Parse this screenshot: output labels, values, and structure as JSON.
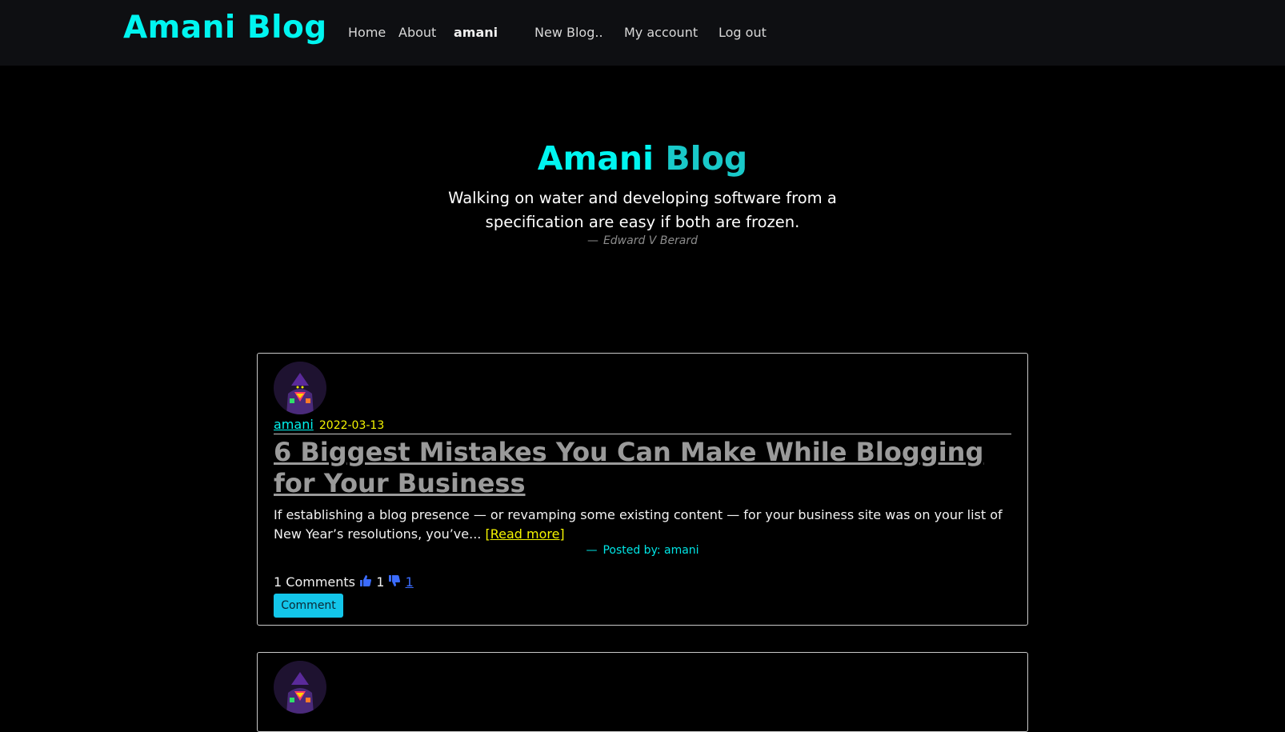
{
  "nav": {
    "brand": "Amani Blog",
    "links": [
      "Home",
      "About",
      "amani",
      "New Blog..",
      "My account",
      "Log out"
    ]
  },
  "hero": {
    "title_part1": "Amani",
    "title_part2": "Blog",
    "quote": "Walking on water and developing software from a specification are easy if both are frozen.",
    "dash": "—",
    "author": "Edward V Berard"
  },
  "posts": [
    {
      "author": "amani",
      "date": "2022-03-13",
      "title": "6 Biggest Mistakes You Can Make While Blogging for Your Business",
      "excerpt": "If establishing a blog presence — or revamping some existing content — for your business site was on your list of New Year’s resolutions, you’ve...",
      "read_more": "[Read more]",
      "dash": "—",
      "posted_by": "Posted by: amani",
      "comments": "1 Comments",
      "likes": "1",
      "dislikes": "1",
      "comment_button": "Comment"
    }
  ],
  "icons": {
    "like": "thumbs-up-icon",
    "dislike": "thumbs-down-icon",
    "avatar": "avatar-image"
  },
  "colors": {
    "accent": "#00f5f0",
    "date": "#f4f400",
    "button": "#13c6ea",
    "thumb": "#3b6cff"
  }
}
